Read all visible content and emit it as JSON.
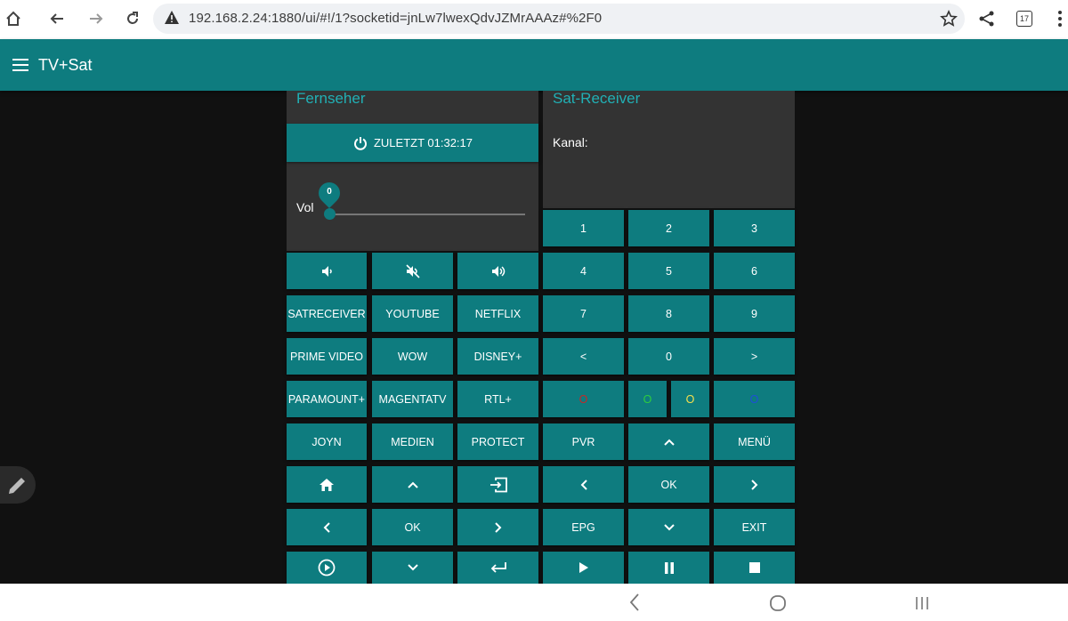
{
  "browser": {
    "url": "192.168.2.24:1880/ui/#!/1?socketid=jnLw7lwexQdvJZMrAAAz#%2F0",
    "tab_count": "17",
    "icons": [
      "home-icon",
      "back-icon",
      "forward-icon",
      "reload-icon",
      "warning-icon",
      "star-icon",
      "share-icon",
      "tabs-icon",
      "more-icon"
    ]
  },
  "app": {
    "title": "TV+Sat",
    "accent_color": "#0e7c7f",
    "title_color": "#21b0b5"
  },
  "tv": {
    "title": "Fernseher",
    "power_label": "ZULETZT 01:32:17",
    "vol_label": "Vol",
    "vol_value": "0",
    "vol_level": 0,
    "row1": [
      "volume-down-icon",
      "mute-icon",
      "volume-up-icon"
    ],
    "apps": [
      [
        "SATRECEIVER",
        "YOUTUBE",
        "NETFLIX"
      ],
      [
        "PRIME VIDEO",
        "WOW",
        "DISNEY+"
      ],
      [
        "PARAMOUNT+",
        "MAGENTATV",
        "RTL+"
      ],
      [
        "JOYN",
        "MEDIEN",
        "PROTECT"
      ]
    ],
    "nav": {
      "home": "home-icon",
      "up": "^",
      "input": "input-icon",
      "left": "<",
      "ok": "OK",
      "right": ">",
      "play": "play-circle-icon",
      "down": "v",
      "return": "return-icon"
    }
  },
  "sat": {
    "title": "Sat-Receiver",
    "kanal_label": "Kanal:",
    "numpad": [
      [
        "1",
        "2",
        "3"
      ],
      [
        "4",
        "5",
        "6"
      ],
      [
        "7",
        "8",
        "9"
      ],
      [
        "<",
        "0",
        ">"
      ]
    ],
    "color_buttons": [
      {
        "label": "O",
        "color": "#c62828"
      },
      {
        "label": "O",
        "color": "#2ecc40"
      },
      {
        "label": "O",
        "color": "#f4e04d"
      },
      {
        "label": "O",
        "color": "#1f4fd8"
      }
    ],
    "row_pvr": [
      "PVR",
      "^",
      "MENÜ"
    ],
    "row_ok": [
      "<",
      "OK",
      ">"
    ],
    "row_epg": [
      "EPG",
      "v",
      "EXIT"
    ],
    "row_media": [
      "play-icon",
      "pause-icon",
      "stop-icon"
    ]
  }
}
